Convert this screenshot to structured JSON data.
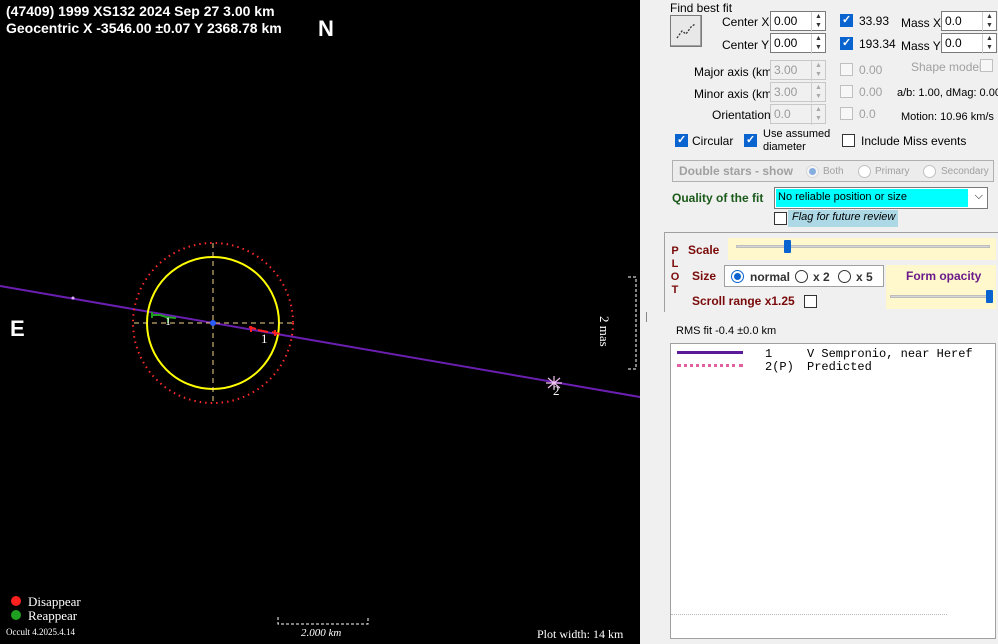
{
  "plot": {
    "title_line1": "(47409) 1999 XS132  2024 Sep 27   3.00 km",
    "title_line2": "Geocentric  X  -3546.00 ±0.07  Y 2368.78 km",
    "north_label": "N",
    "east_label": "E",
    "scale_bar_label": "2.000 km",
    "mas_label": "2 mas",
    "plot_width_label": "Plot width: 14 km",
    "version_label": "Occult 4.2025.4.14",
    "legend": [
      {
        "label": "Disappear",
        "color": "#ff2020"
      },
      {
        "label": "Reappear",
        "color": "#20a020"
      }
    ],
    "chord_labels": [
      "1",
      "1",
      "2"
    ],
    "colors": {
      "chord": "#6a1fb0",
      "ellipse": "#ffff00",
      "predicted": "#ff2a2a",
      "axes": "#f5d58a",
      "center": "#2a5cff"
    }
  },
  "fit": {
    "find_best_fit_label": "Find best fit",
    "center_x_label": "Center X",
    "center_x_value": "0.00",
    "center_y_label": "Center Y",
    "center_y_value": "0.00",
    "check_x_value": "33.93",
    "check_y_value": "193.34",
    "mass_x_label": "Mass X",
    "mass_x_value": "0.0",
    "mass_y_label": "Mass Y",
    "mass_y_value": "0.0",
    "major_axis_label": "Major axis (km)",
    "major_axis_value": "3.00",
    "major_axis_check_value": "0.00",
    "minor_axis_label": "Minor axis (km)",
    "minor_axis_value": "3.00",
    "minor_axis_check_value": "0.00",
    "orientation_label": "Orientation",
    "orientation_value": "0.0",
    "orientation_check_value": "0.0",
    "shape_model_label": "Shape model",
    "ab_label": "a/b: 1.00, dMag: 0.00",
    "motion_label": "Motion: 10.96 km/s",
    "circular_label": "Circular",
    "use_assumed_label": "Use assumed diameter",
    "include_miss_label": "Include Miss events",
    "double_stars_label": "Double stars - show",
    "both_label": "Both",
    "primary_label": "Primary",
    "secondary_label": "Secondary",
    "quality_label": "Quality of the fit",
    "quality_value": "No reliable position or size",
    "flag_label": "Flag for future review"
  },
  "plot_controls": {
    "plot_letters": "P L O T",
    "scale_label": "Scale",
    "scale_level": 0.2,
    "size_label": "Size",
    "normal_label": "normal",
    "x2_label": "x 2",
    "x5_label": "x 5",
    "form_opacity_label": "Form opacity",
    "opacity_level": 1.0,
    "scroll_range_label": "Scroll range x1.25"
  },
  "rms": {
    "label": "RMS fit -0.4 ±0.0 km"
  },
  "legend_list": [
    {
      "index": "1",
      "name": "V Sempronio, near Heref"
    },
    {
      "index": "2(P)",
      "name": "Predicted"
    }
  ]
}
